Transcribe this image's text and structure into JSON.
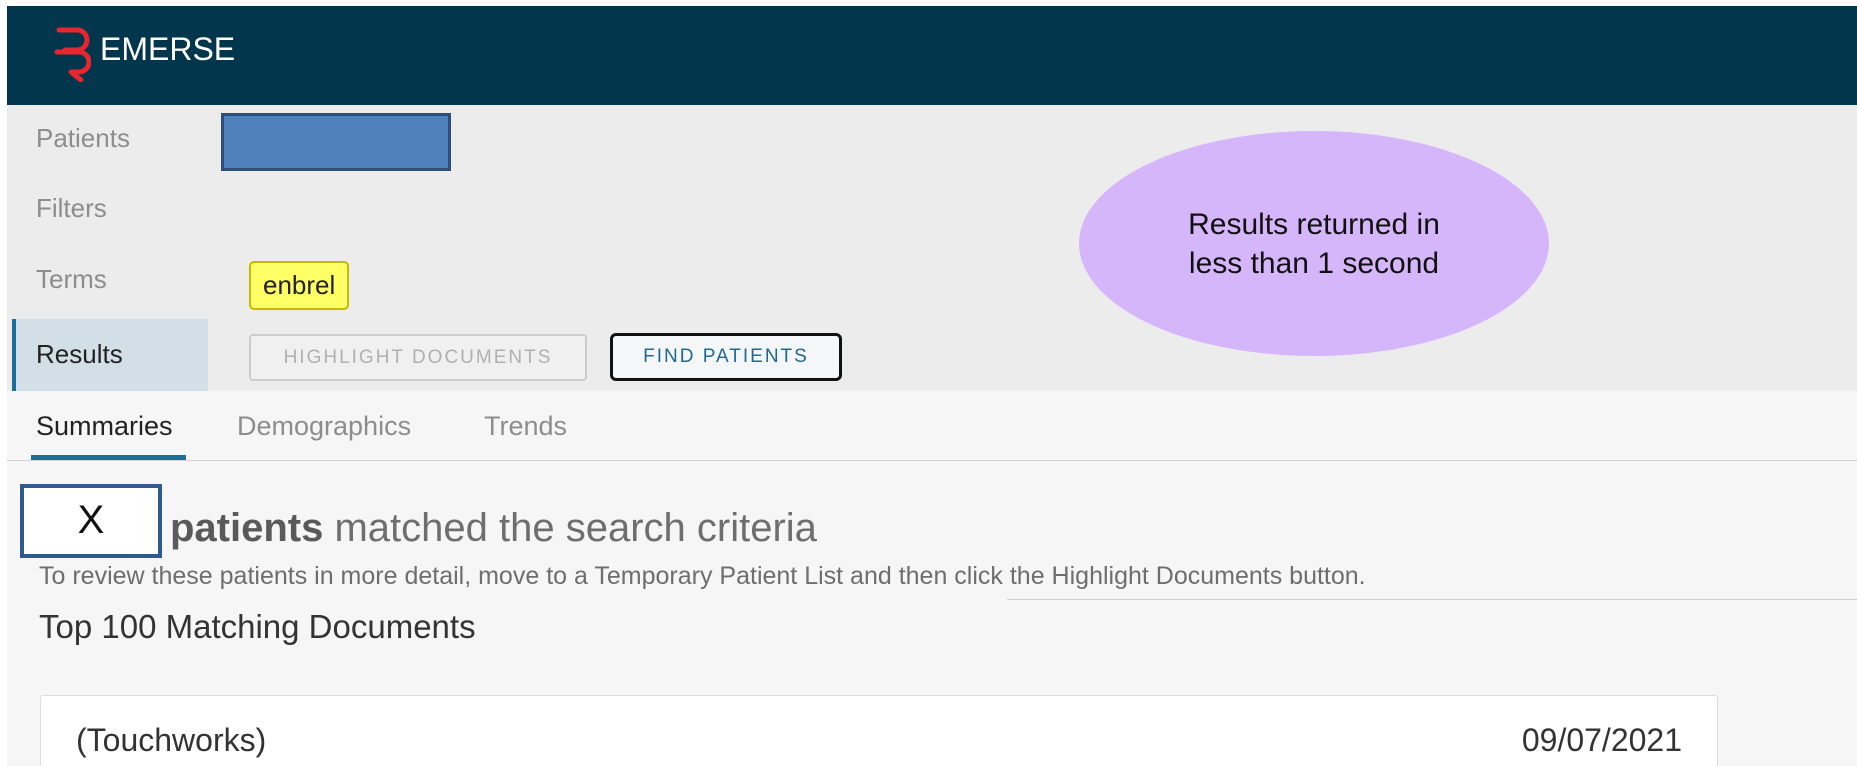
{
  "header": {
    "brand": "EMERSE",
    "accent_color": "#e8262d",
    "bar_color": "#02364d"
  },
  "query": {
    "labels": {
      "patients": "Patients",
      "filters": "Filters",
      "terms": "Terms",
      "results": "Results"
    },
    "terms": [
      "enbrel"
    ],
    "buttons": {
      "highlight": "HIGHLIGHT DOCUMENTS",
      "find": "FIND PATIENTS"
    }
  },
  "callout": {
    "text": "Results returned in less than 1 second",
    "color": "#d6b6fb"
  },
  "tabs": {
    "summaries": "Summaries",
    "demographics": "Demographics",
    "trends": "Trends",
    "active": "Summaries"
  },
  "results": {
    "count": "X",
    "patients_word": "patients",
    "match_text": " matched the search criteria",
    "instructions": "To review these patients in more detail, move to a Temporary Patient List and then click the Highlight Documents button.",
    "section_title": "Top 100 Matching Documents"
  },
  "documents": [
    {
      "source": "(Touchworks)",
      "date": "09/07/2021"
    }
  ]
}
